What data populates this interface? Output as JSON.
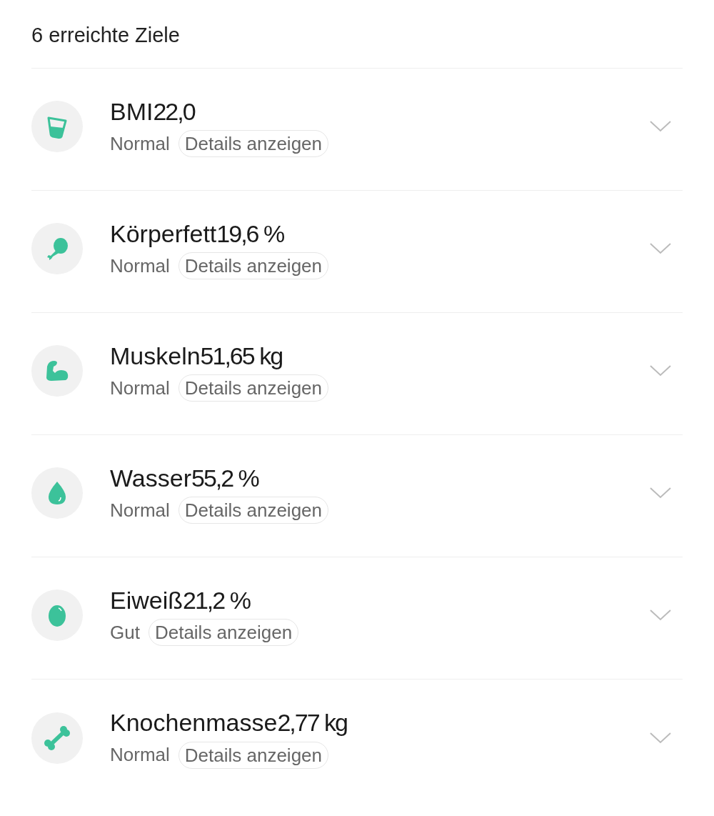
{
  "header": {
    "title": "6 erreichte Ziele"
  },
  "items": [
    {
      "name": "BMI",
      "value": "22,0",
      "status": "Normal",
      "details": "Details anzeigen"
    },
    {
      "name": "Körperfett",
      "value": "19,6 %",
      "status": "Normal",
      "details": "Details anzeigen"
    },
    {
      "name": "Muskeln",
      "value": "51,65 kg",
      "status": "Normal",
      "details": "Details anzeigen"
    },
    {
      "name": "Wasser",
      "value": "55,2 %",
      "status": "Normal",
      "details": "Details anzeigen"
    },
    {
      "name": "Eiweiß",
      "value": "21,2 %",
      "status": "Gut",
      "details": "Details anzeigen"
    },
    {
      "name": "Knochenmasse",
      "value": "2,77 kg",
      "status": "Normal",
      "details": "Details anzeigen"
    }
  ]
}
